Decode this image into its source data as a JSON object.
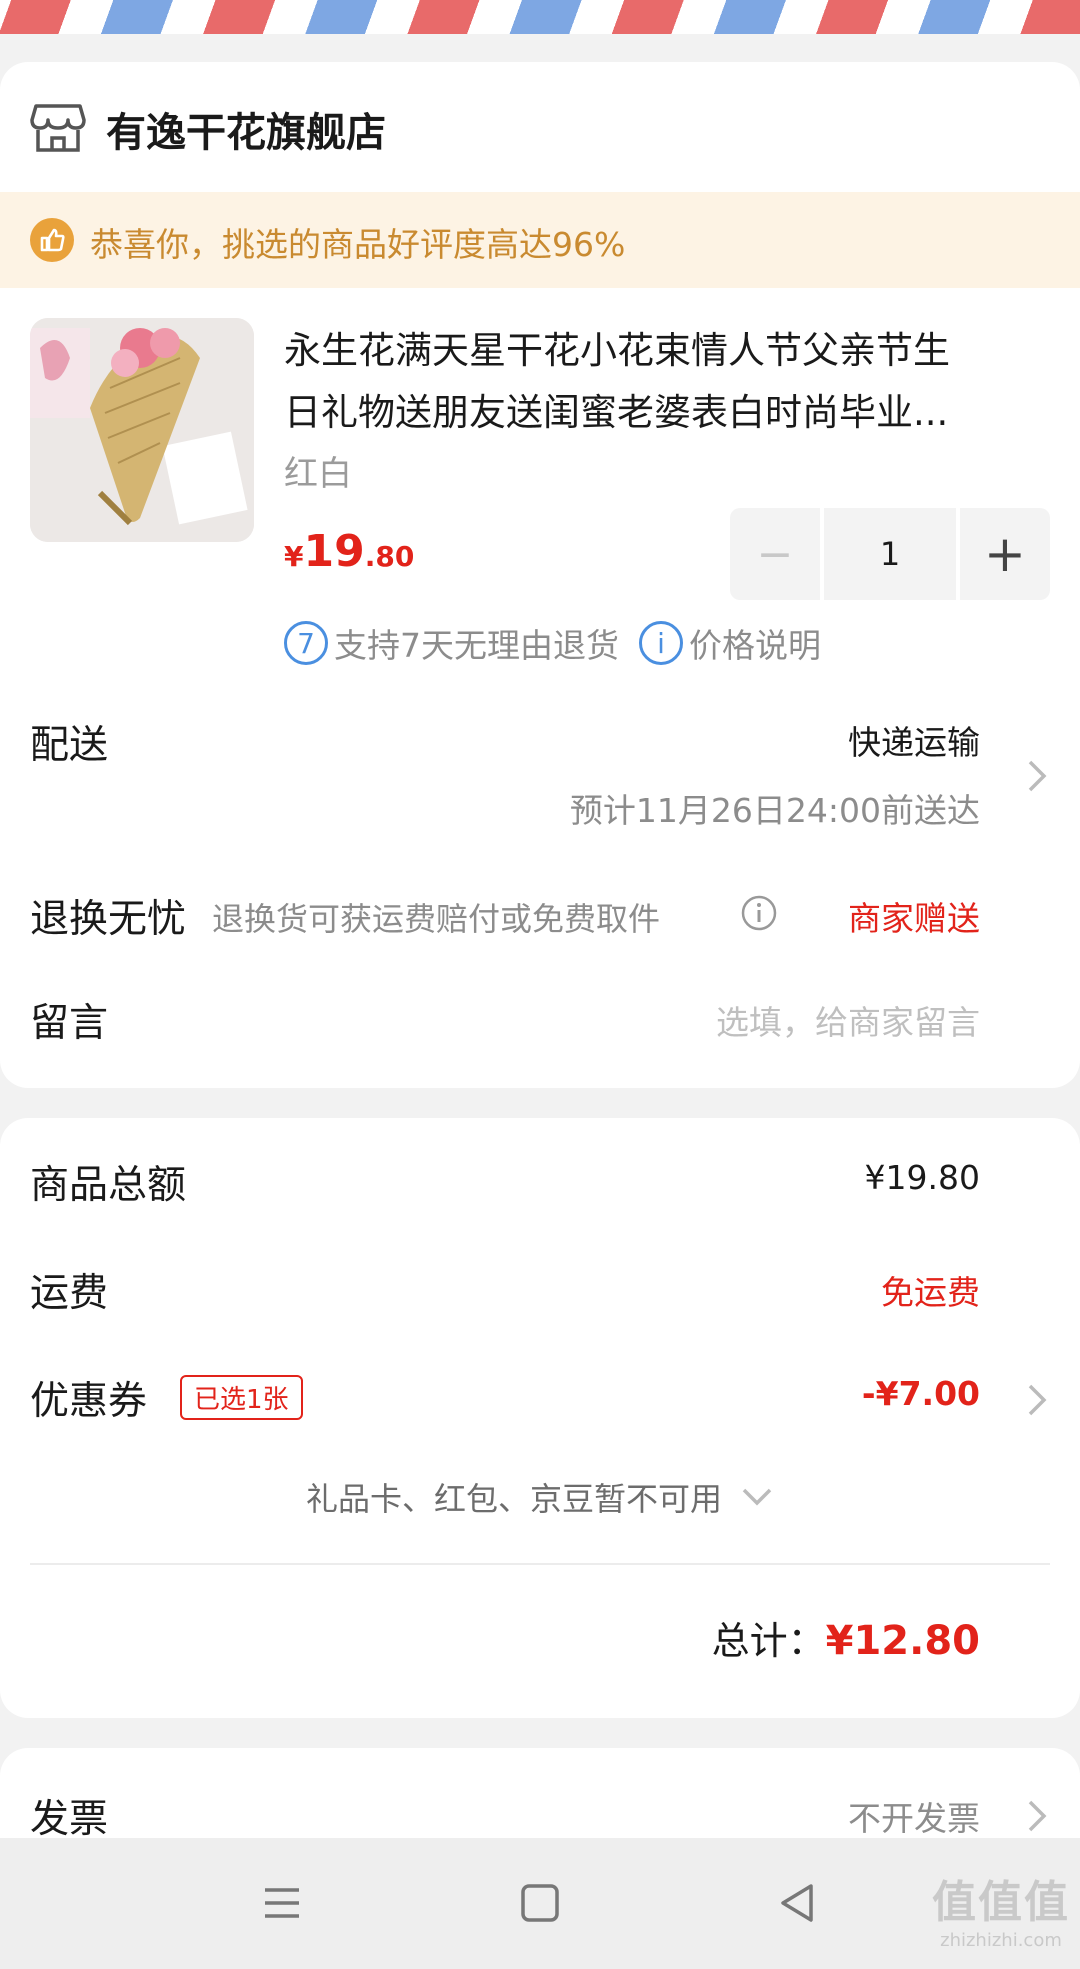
{
  "store": {
    "name": "有逸干花旗舰店",
    "icon": "store-icon"
  },
  "banner": {
    "text": "恭喜你，挑选的商品好评度高达96%",
    "icon": "thumbs-up-icon"
  },
  "product": {
    "title_line1": "永生花满天星干花小花束情人节父亲节生",
    "title_line2": "日礼物送朋友送闺蜜老婆表白时尚毕业...",
    "spec": "红白",
    "price_symbol": "¥",
    "price_int": "19",
    "price_dec": ".80",
    "qty": "1",
    "minus_label": "−",
    "plus_label": "+",
    "badge_return_num": "7",
    "badge_return_text": "支持7天无理由退货",
    "badge_price_icon": "i",
    "badge_price_text": "价格说明"
  },
  "delivery": {
    "label": "配送",
    "method": "快递运输",
    "eta": "预计11月26日24:00前送达"
  },
  "return_service": {
    "label": "退换无忧",
    "desc": "退换货可获运费赔付或免费取件",
    "value": "商家赠送"
  },
  "message": {
    "label": "留言",
    "placeholder": "选填，给商家留言"
  },
  "summary": {
    "goods_label": "商品总额",
    "goods_value": "¥19.80",
    "shipping_label": "运费",
    "shipping_value": "免运费",
    "coupon_label": "优惠券",
    "coupon_tag": "已选1张",
    "coupon_value": "-¥7.00",
    "unavailable": "礼品卡、红包、京豆暂不可用",
    "total_label": "总计：",
    "total_value": "¥12.80"
  },
  "invoice": {
    "label": "发票",
    "value": "不开发票"
  },
  "watermark": {
    "big": "值值值",
    "small": "zhizhizhi.com"
  },
  "colors": {
    "accent_red": "#e2231a",
    "banner_bg": "#fdf3e4",
    "banner_text": "#c98a30",
    "link_blue": "#4a8fe0"
  }
}
